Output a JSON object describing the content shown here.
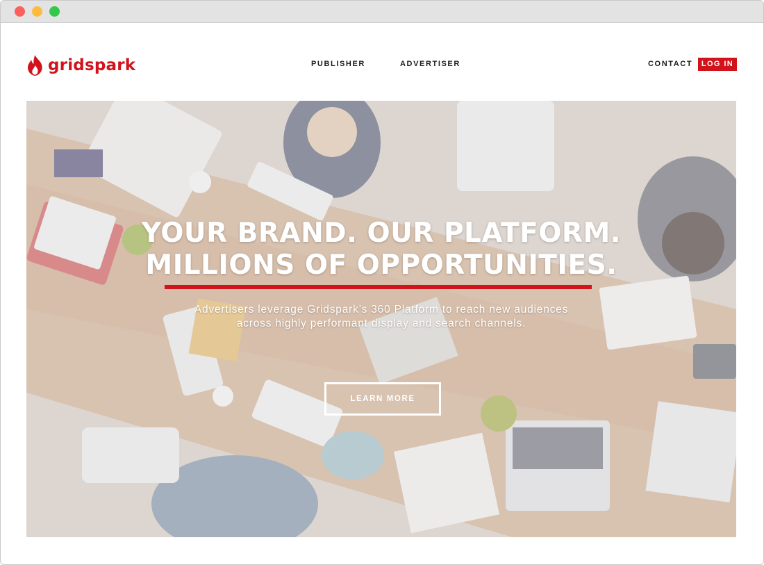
{
  "window": {
    "controls": [
      "close",
      "minimize",
      "maximize"
    ]
  },
  "brand": {
    "name": "gridspark",
    "color": "#d1131c",
    "icon": "flame-icon"
  },
  "nav": {
    "links": [
      "PUBLISHER",
      "ADVERTISER"
    ],
    "contact": "CONTACT",
    "login": "LOG IN"
  },
  "hero": {
    "headline_line1": "YOUR BRAND. OUR PLATFORM.",
    "headline_line2": "MILLIONS OF OPPORTUNITIES.",
    "subtext_line1": "Advertisers leverage Gridspark’s 360 Platform to reach new audiences",
    "subtext_line2": "across highly performant display and search channels.",
    "cta": "LEARN MORE",
    "accent_color": "#d1131c"
  }
}
